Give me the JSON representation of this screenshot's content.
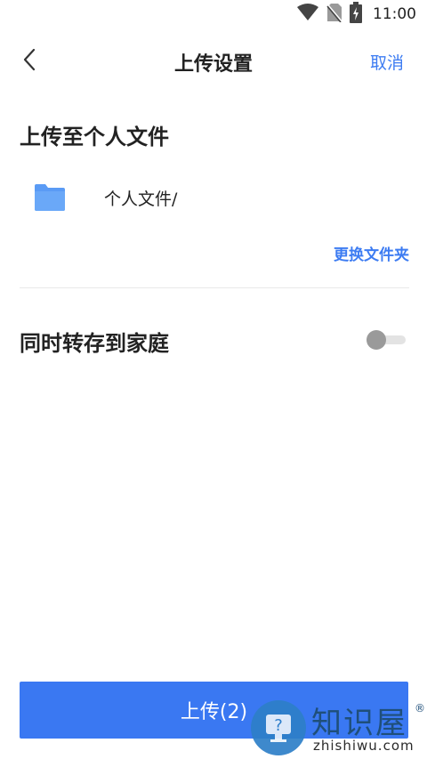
{
  "status_bar": {
    "time": "11:00",
    "icons": [
      "wifi-icon",
      "no-sim-icon",
      "battery-charging-icon"
    ]
  },
  "header": {
    "title": "上传设置",
    "cancel_label": "取消",
    "back_icon": "chevron-left-icon"
  },
  "upload_target": {
    "section_title": "上传至个人文件",
    "folder_icon": "folder-icon",
    "folder_path": "个人文件/",
    "change_folder_label": "更换文件夹"
  },
  "family_save": {
    "label": "同时转存到家庭",
    "enabled": false
  },
  "upload_button": {
    "label": "上传(2)"
  },
  "watermark": {
    "brand": "知识屋",
    "domain": "zhishiwu.com",
    "registered_mark": "®"
  },
  "colors": {
    "accent": "#3d7cf2",
    "button": "#3a78f2",
    "folder": "#5a9bf5"
  }
}
